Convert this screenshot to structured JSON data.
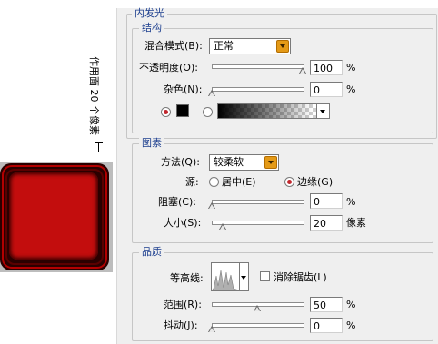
{
  "colors": {
    "accent": "#1d3f8f",
    "preview_red": "#c30d0d",
    "dropdown_button": "#e49a17"
  },
  "side": {
    "label": "作用面 20 个像素"
  },
  "panel": {
    "title": "内发光"
  },
  "structure": {
    "title": "结构",
    "blend_mode": {
      "label": "混合模式(B):",
      "value": "正常"
    },
    "opacity": {
      "label": "不透明度(O):",
      "value": "100",
      "unit": "%",
      "level_percent": 100
    },
    "noise": {
      "label": "杂色(N):",
      "value": "0",
      "unit": "%",
      "level_percent": 0
    },
    "color_swatch": "#000000"
  },
  "elements": {
    "title": "图素",
    "technique": {
      "label": "方法(Q):",
      "value": "较柔软"
    },
    "source": {
      "label": "源:",
      "center": "居中(E)",
      "edge": "边缘(G)",
      "selected": "edge"
    },
    "choke": {
      "label": "阻塞(C):",
      "value": "0",
      "unit": "%",
      "level_percent": 0
    },
    "size": {
      "label": "大小(S):",
      "value": "20",
      "unit": "像素",
      "level_percent": 8
    }
  },
  "quality": {
    "title": "品质",
    "contour": {
      "label": "等高线:"
    },
    "anti_alias": {
      "label": "消除锯齿(L)",
      "checked": false
    },
    "range": {
      "label": "范围(R):",
      "value": "50",
      "unit": "%",
      "level_percent": 50
    },
    "jitter": {
      "label": "抖动(J):",
      "value": "0",
      "unit": "%",
      "level_percent": 0
    }
  }
}
